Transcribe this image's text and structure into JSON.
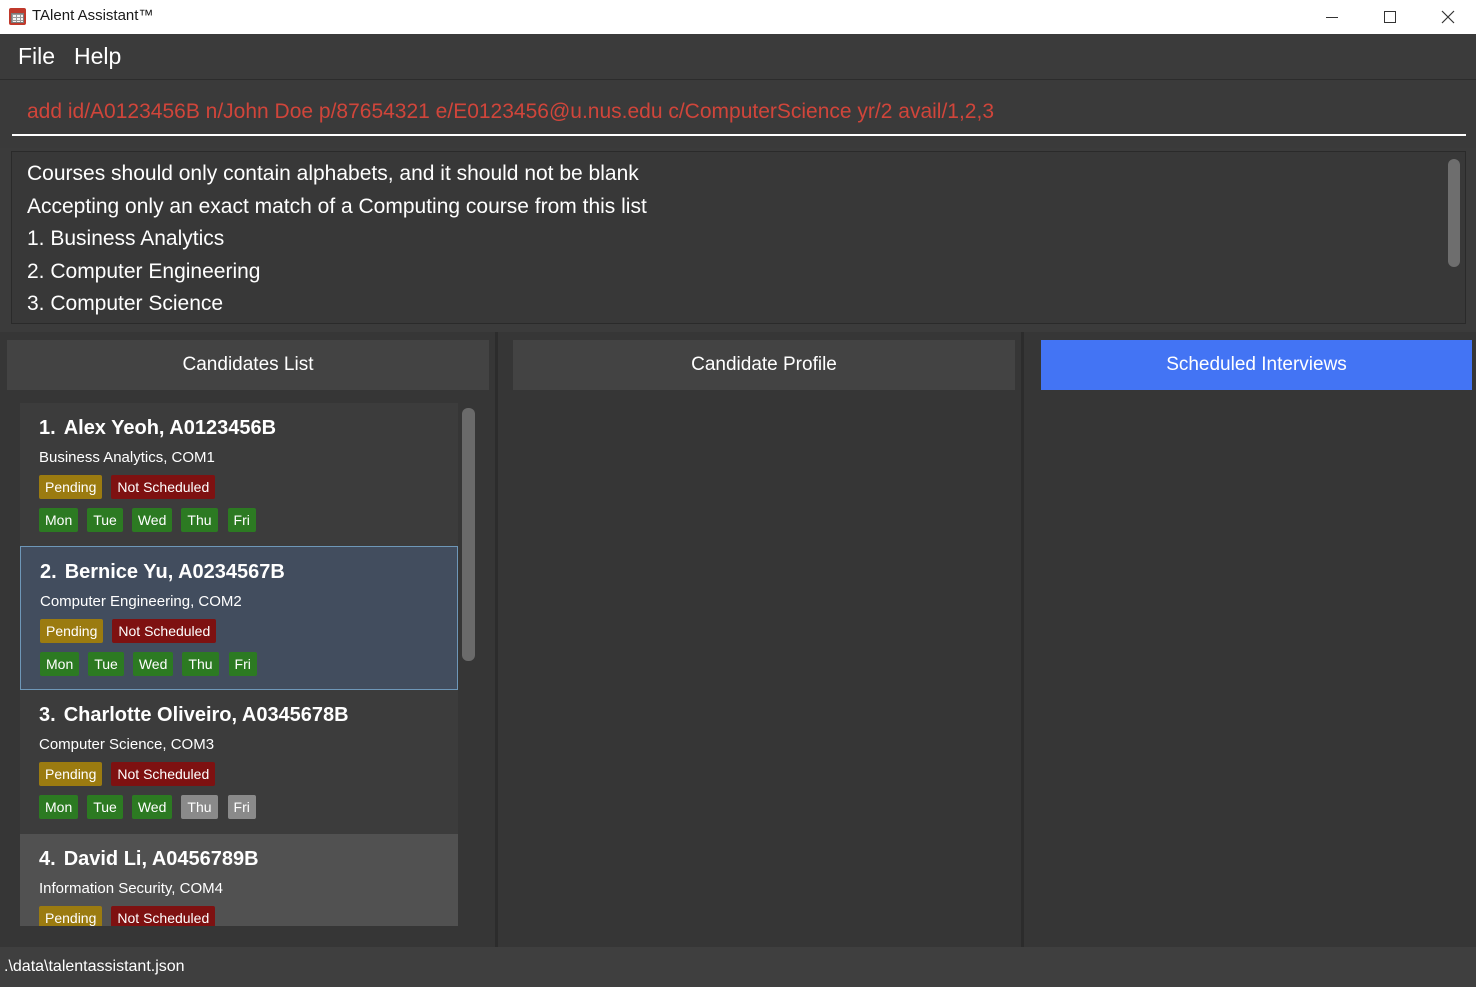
{
  "window": {
    "title": "TAlent Assistant™",
    "controls": {
      "minimize": "minimize-icon",
      "maximize": "maximize-icon",
      "close": "close-icon"
    }
  },
  "menu": {
    "file": "File",
    "help": "Help"
  },
  "command": {
    "value": "add id/A0123456B n/John Doe p/87654321 e/E0123456@u.nus.edu c/ComputerScience yr/2 avail/1,2,3",
    "error_color": "#d0453a"
  },
  "result": {
    "lines": [
      "Courses should only contain alphabets, and it should not be blank",
      "Accepting only an exact match of a Computing course from this list",
      "1. Business Analytics",
      "2. Computer Engineering",
      "3. Computer Science"
    ]
  },
  "panels": {
    "candidates_list": "Candidates List",
    "candidate_profile": "Candidate Profile",
    "scheduled_interviews": "Scheduled Interviews",
    "active_color": "#4374f4"
  },
  "candidates": [
    {
      "index": "1.",
      "name": "Alex Yeoh, A0123456B",
      "course": "Business Analytics, COM1",
      "status": "Pending",
      "interview": "Not Scheduled",
      "days": [
        {
          "label": "Mon",
          "available": true
        },
        {
          "label": "Tue",
          "available": true
        },
        {
          "label": "Wed",
          "available": true
        },
        {
          "label": "Thu",
          "available": true
        },
        {
          "label": "Fri",
          "available": true
        }
      ]
    },
    {
      "index": "2.",
      "name": "Bernice Yu, A0234567B",
      "course": "Computer Engineering, COM2",
      "status": "Pending",
      "interview": "Not Scheduled",
      "days": [
        {
          "label": "Mon",
          "available": true
        },
        {
          "label": "Tue",
          "available": true
        },
        {
          "label": "Wed",
          "available": true
        },
        {
          "label": "Thu",
          "available": true
        },
        {
          "label": "Fri",
          "available": true
        }
      ]
    },
    {
      "index": "3.",
      "name": "Charlotte Oliveiro, A0345678B",
      "course": "Computer Science, COM3",
      "status": "Pending",
      "interview": "Not Scheduled",
      "days": [
        {
          "label": "Mon",
          "available": true
        },
        {
          "label": "Tue",
          "available": true
        },
        {
          "label": "Wed",
          "available": true
        },
        {
          "label": "Thu",
          "available": false
        },
        {
          "label": "Fri",
          "available": false
        }
      ]
    },
    {
      "index": "4.",
      "name": "David Li, A0456789B",
      "course": "Information Security, COM4",
      "status": "Pending",
      "interview": "Not Scheduled",
      "days": []
    }
  ],
  "status_colors": {
    "pending": "#9b7b10",
    "not_scheduled": "#7e1111",
    "available": "#2c7a22",
    "unavailable": "#8a8a8a"
  },
  "statusbar": {
    "path": ".\\data\\talentassistant.json"
  }
}
